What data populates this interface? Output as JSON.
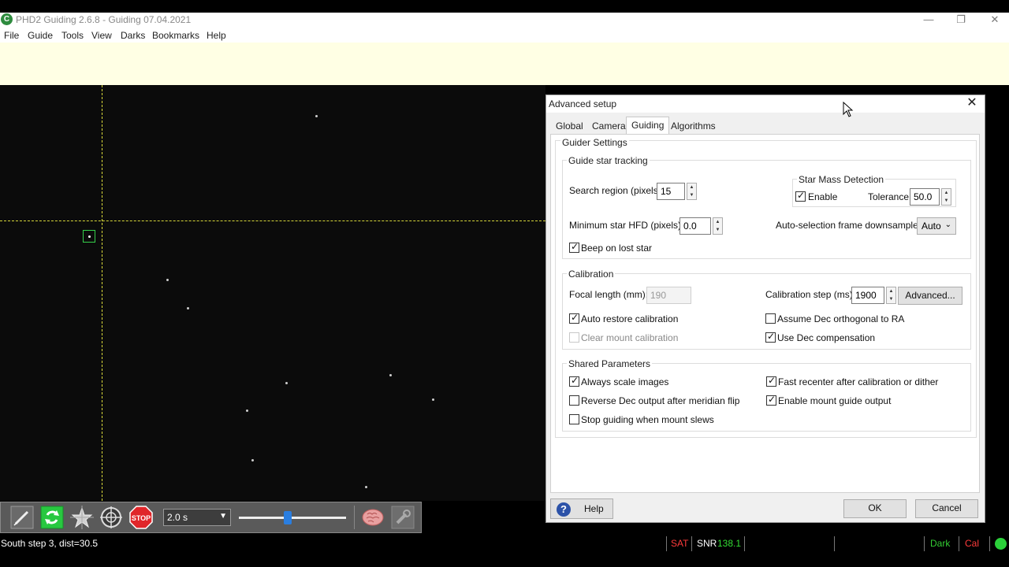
{
  "app": {
    "title": "PHD2 Guiding 2.6.8 - Guiding 07.04.2021",
    "icon_letter": "C",
    "window_controls": [
      "—",
      "❐",
      "✕"
    ]
  },
  "menu": [
    "File",
    "Guide",
    "Tools",
    "View",
    "Darks",
    "Bookmarks",
    "Help"
  ],
  "toolbar": {
    "exposure": "2.0 s",
    "gamma_fraction": 0.45,
    "icons": [
      "loop-pencil-icon",
      "loop-icon",
      "star-auto-select-icon",
      "guide-target-icon",
      "stop-icon",
      "brain-icon",
      "wrench-icon"
    ],
    "stop_label": "STOP"
  },
  "status": {
    "text": "South step   3, dist=30.5",
    "sat": "SAT",
    "snr_label": "SNR",
    "snr_value": "138.1",
    "dark": "Dark",
    "cal": "Cal",
    "colors": {
      "sat": "#ff3b3b",
      "snr_value": "#33dd33",
      "dark": "#33cc33",
      "cal": "#ff3b3b",
      "led": "#2bd03a"
    }
  },
  "dialog": {
    "title": "Advanced setup",
    "close": "✕",
    "tabs": [
      "Global",
      "Camera",
      "Guiding",
      "Algorithms"
    ],
    "active_tab": "Guiding",
    "guider_settings": "Guider Settings",
    "star_tracking": {
      "title": "Guide star tracking",
      "search_region_label": "Search region (pixels):",
      "search_region_value": "15",
      "min_hfd_label": "Minimum star HFD (pixels):",
      "min_hfd_value": "0.0",
      "star_mass_title": "Star Mass Detection",
      "enable_label": "Enable",
      "enable_checked": true,
      "tolerance_label": "Tolerance:",
      "tolerance_value": "50.0",
      "downsample_label": "Auto-selection frame downsample:",
      "downsample_value": "Auto",
      "beep_label": "Beep on lost star",
      "beep_checked": true
    },
    "calibration": {
      "title": "Calibration",
      "focal_label": "Focal length (mm):",
      "focal_value": "190",
      "step_label": "Calibration step (ms):",
      "step_value": "1900",
      "advanced_button": "Advanced...",
      "auto_restore_label": "Auto restore calibration",
      "auto_restore_checked": true,
      "clear_mount_label": "Clear mount calibration",
      "clear_mount_checked": false,
      "assume_dec_label": "Assume Dec orthogonal to RA",
      "assume_dec_checked": false,
      "use_dec_comp_label": "Use Dec compensation",
      "use_dec_comp_checked": true
    },
    "shared": {
      "title": "Shared Parameters",
      "always_scale_label": "Always scale images",
      "always_scale_checked": true,
      "fast_recenter_label": "Fast recenter after calibration or dither",
      "fast_recenter_checked": true,
      "reverse_dec_label": "Reverse Dec output after meridian flip",
      "reverse_dec_checked": false,
      "enable_mount_label": "Enable mount guide output",
      "enable_mount_checked": true,
      "stop_guiding_label": "Stop guiding when mount slews",
      "stop_guiding_checked": false
    },
    "help_button": "Help",
    "help_icon": "?",
    "ok_button": "OK",
    "cancel_button": "Cancel"
  }
}
